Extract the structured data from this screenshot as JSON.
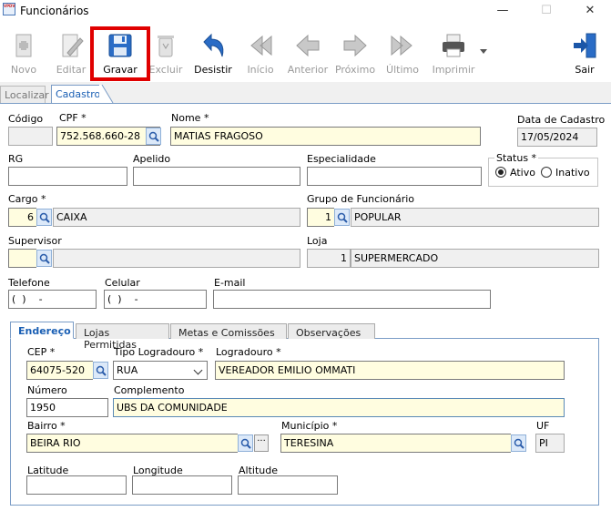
{
  "window": {
    "title": "Funcionários",
    "app_icon_text": "VPDV",
    "minimize": "—",
    "maximize": "☐",
    "close": "✕"
  },
  "toolbar": {
    "novo": "Novo",
    "editar": "Editar",
    "gravar": "Gravar",
    "excluir": "Excluir",
    "desistir": "Desistir",
    "inicio": "Início",
    "anterior": "Anterior",
    "proximo": "Próximo",
    "ultimo": "Último",
    "imprimir": "Imprimir",
    "sair": "Sair"
  },
  "tabs": {
    "localizar": "Localizar",
    "cadastro": "Cadastro"
  },
  "form": {
    "codigo_label": "Código",
    "codigo": "",
    "cpf_label": "CPF *",
    "cpf": "752.568.660-28",
    "nome_label": "Nome *",
    "nome": "MATIAS FRAGOSO",
    "data_label": "Data de Cadastro",
    "data": "17/05/2024",
    "rg_label": "RG",
    "rg": "",
    "apelido_label": "Apelido",
    "apelido": "",
    "especialidade_label": "Especialidade",
    "especialidade": "",
    "status_label": "Status *",
    "ativo": "Ativo",
    "inativo": "Inativo",
    "cargo_label": "Cargo *",
    "cargo_id": "6",
    "cargo": "CAIXA",
    "grupo_label": "Grupo de Funcionário",
    "grupo_id": "1",
    "grupo": "POPULAR",
    "supervisor_label": "Supervisor",
    "supervisor_id": "",
    "supervisor": "",
    "loja_label": "Loja",
    "loja_id": "1",
    "loja": "SUPERMERCADO",
    "telefone_label": "Telefone",
    "telefone": "(  )    -",
    "celular_label": "Celular",
    "celular": "(  )    -",
    "email_label": "E-mail",
    "email": ""
  },
  "subtabs": {
    "endereco": "Endereço",
    "lojas": "Lojas Permitidas",
    "metas": "Metas e Comissões",
    "obs": "Observações"
  },
  "address": {
    "cep_label": "CEP *",
    "cep": "64075-520",
    "tipo_label": "Tipo Logradouro *",
    "tipo": "RUA",
    "logradouro_label": "Logradouro *",
    "logradouro": "VEREADOR EMILIO OMMATI",
    "numero_label": "Número",
    "numero": "1950",
    "complemento_label": "Complemento",
    "complemento": "UBS DA COMUNIDADE",
    "bairro_label": "Bairro *",
    "bairro": "BEIRA RIO",
    "municipio_label": "Município *",
    "municipio": "TERESINA",
    "uf_label": "UF",
    "uf": "PI",
    "latitude_label": "Latitude",
    "latitude": "",
    "longitude_label": "Longitude",
    "longitude": "",
    "altitude_label": "Altitude",
    "altitude": ""
  },
  "colors": {
    "accent": "#1a5fb4",
    "highlight": "#e00000",
    "required_field": "#fffde0"
  }
}
